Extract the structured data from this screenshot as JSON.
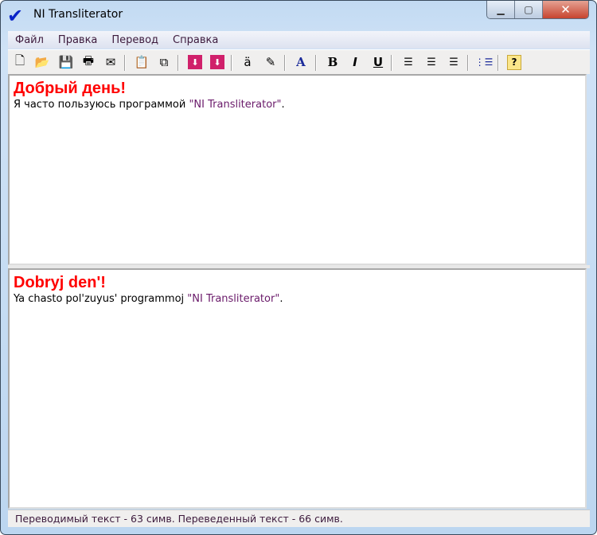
{
  "window": {
    "title": "NI Transliterator",
    "minimize": "▁",
    "maximize": "▢",
    "close": "✕"
  },
  "menu": [
    "Файл",
    "Правка",
    "Перевод",
    "Справка"
  ],
  "toolbar": [
    {
      "name": "new-document",
      "glyph": "🗋"
    },
    {
      "name": "open-folder",
      "glyph": "📂"
    },
    {
      "name": "save",
      "glyph": "💾"
    },
    {
      "name": "print",
      "glyph": "🖶"
    },
    {
      "name": "email",
      "glyph": "✉"
    },
    {
      "name": "paste",
      "glyph": "📋"
    },
    {
      "name": "copy",
      "glyph": "⧉"
    },
    {
      "name": "translate-down",
      "glyph": "⬇"
    },
    {
      "name": "translate-down-alt",
      "glyph": "⬇"
    },
    {
      "name": "swap-alphabet",
      "glyph": "ä"
    },
    {
      "name": "edit-document",
      "glyph": "✎"
    },
    {
      "name": "font",
      "glyph": "A"
    },
    {
      "name": "bold",
      "glyph": "B"
    },
    {
      "name": "italic",
      "glyph": "I"
    },
    {
      "name": "underline",
      "glyph": "U"
    },
    {
      "name": "align-left",
      "glyph": "☰"
    },
    {
      "name": "align-center",
      "glyph": "☰"
    },
    {
      "name": "align-right",
      "glyph": "☰"
    },
    {
      "name": "bullet-list",
      "glyph": "⋮☰"
    },
    {
      "name": "help",
      "glyph": "?"
    }
  ],
  "source": {
    "heading": "Добрый день!",
    "text_before": "Я часто пользуюсь программой ",
    "quote": "\"NI Transliterator\"",
    "text_after": "."
  },
  "target": {
    "heading": "Dobryj den'!",
    "text_before": "Ya chasto pol'zuyus' programmoj ",
    "quote": "\"NI Transliterator\"",
    "text_after": "."
  },
  "status": "Переводимый текст - 63 симв. Переведенный текст - 66 симв."
}
